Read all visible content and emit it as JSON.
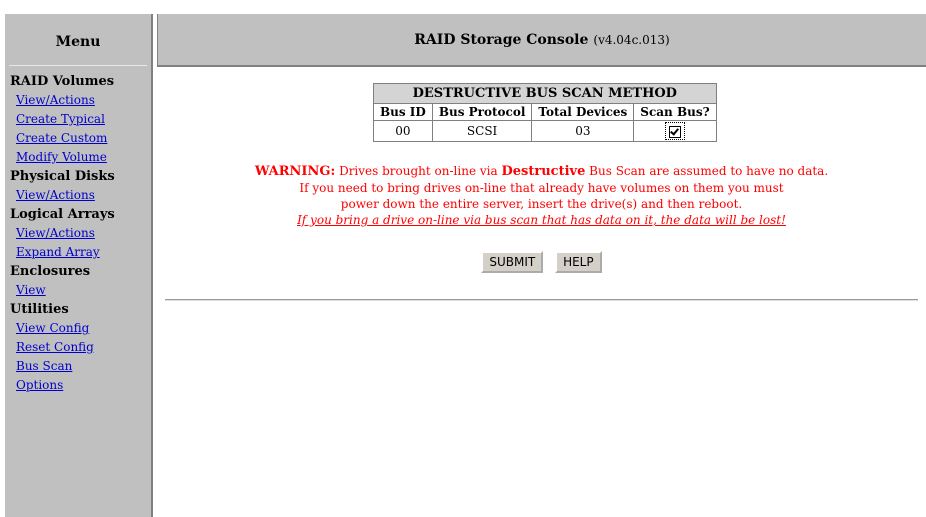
{
  "sidebar": {
    "title": "Menu",
    "sections": [
      {
        "label": "RAID Volumes",
        "links": [
          "View/Actions",
          "Create Typical",
          "Create Custom",
          "Modify Volume"
        ]
      },
      {
        "label": "Physical Disks",
        "links": [
          "View/Actions"
        ]
      },
      {
        "label": "Logical Arrays",
        "links": [
          "View/Actions",
          "Expand Array"
        ]
      },
      {
        "label": "Enclosures",
        "links": [
          "View"
        ]
      },
      {
        "label": "Utilities",
        "links": [
          "View Config",
          "Reset Config",
          "Bus Scan",
          "Options"
        ]
      }
    ]
  },
  "header": {
    "title": "RAID Storage Console",
    "version": "(v4.04c.013)"
  },
  "scan_table": {
    "caption": "DESTRUCTIVE BUS SCAN METHOD",
    "columns": [
      "Bus ID",
      "Bus Protocol",
      "Total Devices",
      "Scan Bus?"
    ],
    "rows": [
      {
        "bus_id": "00",
        "protocol": "SCSI",
        "total_devices": "03",
        "scan_bus_checked": true
      }
    ]
  },
  "warning": {
    "label": "WARNING:",
    "line1_pre": "Drives brought on-line via",
    "line1_bold": "Destructive",
    "line1_post": "Bus Scan are assumed to have no data.",
    "line2": "If you need to bring drives on-line that already have volumes on them you must",
    "line3": "power down the entire server, insert the drive(s) and then reboot.",
    "line4": "If you bring a drive on-line via bus scan that has data on it, the data will be lost!"
  },
  "buttons": {
    "submit": "SUBMIT",
    "help": "HELP"
  },
  "colors": {
    "panel": "#c0c0c0",
    "link": "#0000cc",
    "warning": "#ff0000"
  }
}
